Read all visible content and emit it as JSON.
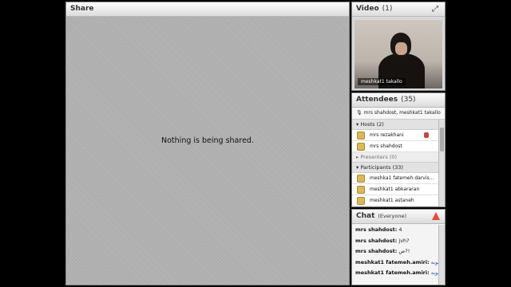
{
  "share": {
    "title": "Share",
    "message": "Nothing is being shared."
  },
  "video": {
    "title": "Video",
    "count": "(1)",
    "name_tag": "meshkat1 takallo"
  },
  "attendees": {
    "title": "Attendees",
    "count": "(35)",
    "speakers": "mrs shahdost, meshkat1 takallo",
    "groups": [
      {
        "label": "Hosts (2)",
        "rows": [
          "mrs rezakhani",
          "mrs shahdost"
        ]
      },
      {
        "label": "Presenters (0)",
        "rows": []
      },
      {
        "label": "Participants (33)",
        "rows": [
          "meshka1 fatemeh.darvis...",
          "meshkat1 abkararan",
          "meshkat1 astaneh"
        ]
      }
    ]
  },
  "chat": {
    "title": "Chat",
    "scope": "(Everyone)",
    "messages": [
      {
        "sender": "mrs shahdost:",
        "text": "4"
      },
      {
        "sender": "mrs shahdost:",
        "text": "jvh?"
      },
      {
        "sender": "mrs shahdost:",
        "text": "ص?!"
      },
      {
        "sender": "meshkat1 fatemeh.amiri:",
        "text": "خوبه"
      },
      {
        "sender": "meshkat1 fatemeh.amiri:",
        "text": "خوبه"
      }
    ]
  }
}
